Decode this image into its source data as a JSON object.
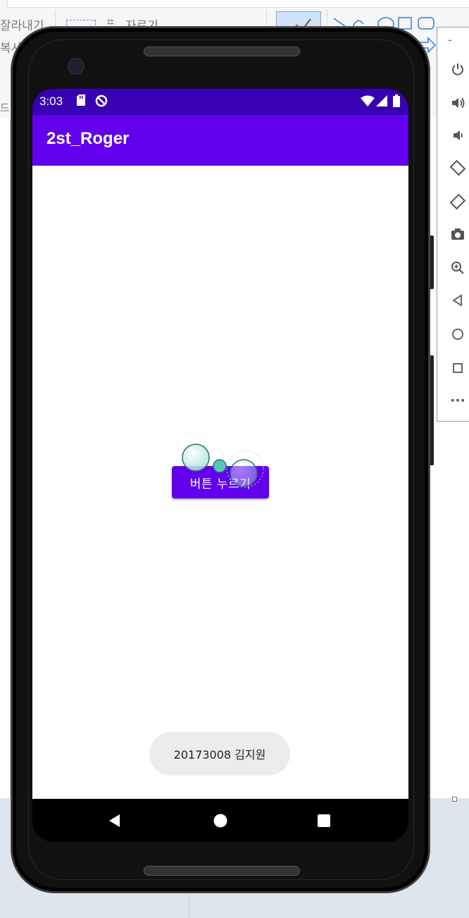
{
  "background_app": {
    "ribbon_labels": [
      "잘라내기",
      "복사",
      "자르기",
      "드"
    ]
  },
  "emulator_toolbar": {
    "buttons": [
      "minimize",
      "power-icon",
      "volume-up-icon",
      "volume-down-icon",
      "rotate-left-icon",
      "rotate-right-icon",
      "camera-icon",
      "zoom-icon",
      "back-icon",
      "home-icon",
      "overview-icon",
      "more-icon"
    ],
    "minimize_label": "-",
    "more_label": "···"
  },
  "status_bar": {
    "time": "3:03",
    "color": "#3700b3"
  },
  "app_bar": {
    "title": "2st_Roger",
    "color": "#6200ee"
  },
  "main": {
    "button_label": "버튼 누르기"
  },
  "toast": {
    "text": "20173008 김지원"
  },
  "colors": {
    "primary": "#6200ee",
    "primary_dark": "#3700b3"
  }
}
